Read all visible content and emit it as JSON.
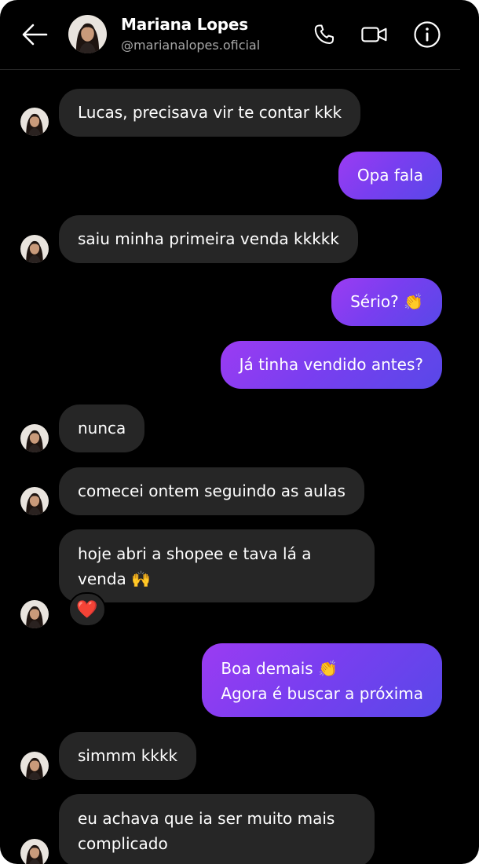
{
  "header": {
    "name": "Mariana Lopes",
    "handle": "@marianalopes.oficial",
    "icons": [
      "back-arrow-icon",
      "phone-icon",
      "video-icon",
      "info-icon"
    ]
  },
  "messages": [
    {
      "from": "them",
      "text": "Lucas, precisava vir te contar kkk"
    },
    {
      "from": "me",
      "text": "Opa fala"
    },
    {
      "from": "them",
      "text": "saiu minha primeira venda kkkkk"
    },
    {
      "from": "me",
      "text": "Sério? 👏"
    },
    {
      "from": "me",
      "text": "Já tinha vendido antes?"
    },
    {
      "from": "them",
      "text": "nunca"
    },
    {
      "from": "them",
      "text": "comecei ontem seguindo as aulas"
    },
    {
      "from": "them",
      "text": "hoje abri a shopee e tava lá a venda 🙌",
      "reaction": "❤️"
    },
    {
      "from": "me",
      "text": "Boa demais 👏\nAgora é buscar a próxima"
    },
    {
      "from": "them",
      "text": "simmm kkkk"
    },
    {
      "from": "them",
      "text": "eu achava que ia ser muito mais complicado"
    }
  ],
  "colors": {
    "background": "#000000",
    "incoming_bubble": "#262626",
    "outgoing_gradient_start": "#9b3cf2",
    "outgoing_gradient_end": "#5848e8"
  }
}
